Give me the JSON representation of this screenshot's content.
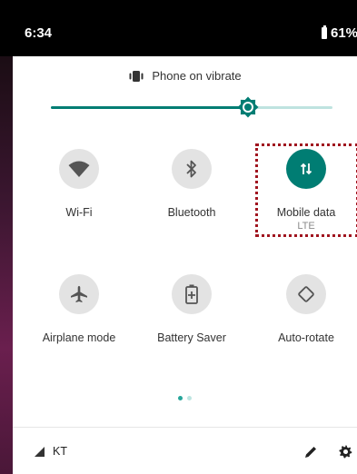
{
  "status_bar": {
    "time": "6:34",
    "battery": "61%"
  },
  "ringer": {
    "label": "Phone on vibrate",
    "icon": "vibrate-icon"
  },
  "brightness": {
    "level_fraction": 0.7,
    "icon": "brightness-icon",
    "accent": "#007d73"
  },
  "tiles": [
    {
      "label": "Wi-Fi",
      "icon": "wifi-icon",
      "active": false
    },
    {
      "label": "Bluetooth",
      "icon": "bluetooth-icon",
      "active": false
    },
    {
      "label": "Mobile data",
      "sublabel": "LTE",
      "icon": "mobile-data-icon",
      "active": true
    },
    {
      "label": "Airplane mode",
      "icon": "airplane-icon",
      "active": false
    },
    {
      "label": "Battery Saver",
      "icon": "battery-saver-icon",
      "active": false
    },
    {
      "label": "Auto-rotate",
      "icon": "auto-rotate-icon",
      "active": false
    }
  ],
  "pages": {
    "current": 1,
    "total": 2
  },
  "footer": {
    "carrier": "KT",
    "edit_icon": "pencil-icon",
    "settings_icon": "gear-icon"
  },
  "colors": {
    "accent": "#007d73",
    "highlight": "#a0151f",
    "inactive_tile": "#e3e3e3"
  }
}
